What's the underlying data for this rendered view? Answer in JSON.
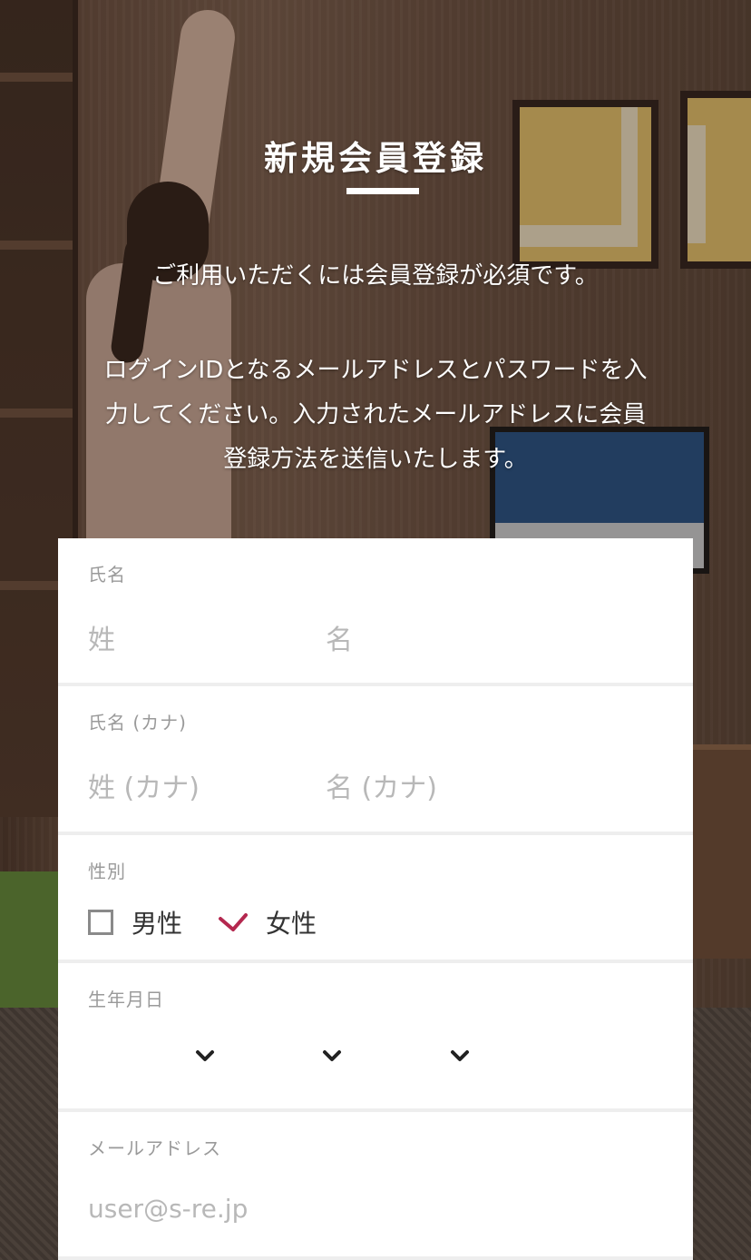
{
  "header": {
    "title": "新規会員登録",
    "lead": "ご利用いただくには会員登録が必須です。",
    "description_lines": [
      "ログインIDとなるメールアドレスとパスワードを入",
      "力してください。入力されたメールアドレスに会員",
      "登録方法を送信いたします。"
    ]
  },
  "form": {
    "name": {
      "label": "氏名",
      "last_placeholder": "姓",
      "first_placeholder": "名"
    },
    "kana": {
      "label": "氏名 (カナ)",
      "last_placeholder": "姓 (カナ)",
      "first_placeholder": "名 (カナ)"
    },
    "gender": {
      "label": "性別",
      "options": [
        {
          "label": "男性",
          "checked": false
        },
        {
          "label": "女性",
          "checked": true
        }
      ],
      "check_color": "#b4284f"
    },
    "birthdate": {
      "label": "生年月日",
      "selects": [
        "year",
        "month",
        "day"
      ]
    },
    "email": {
      "label": "メールアドレス",
      "placeholder": "user@s-re.jp"
    }
  }
}
